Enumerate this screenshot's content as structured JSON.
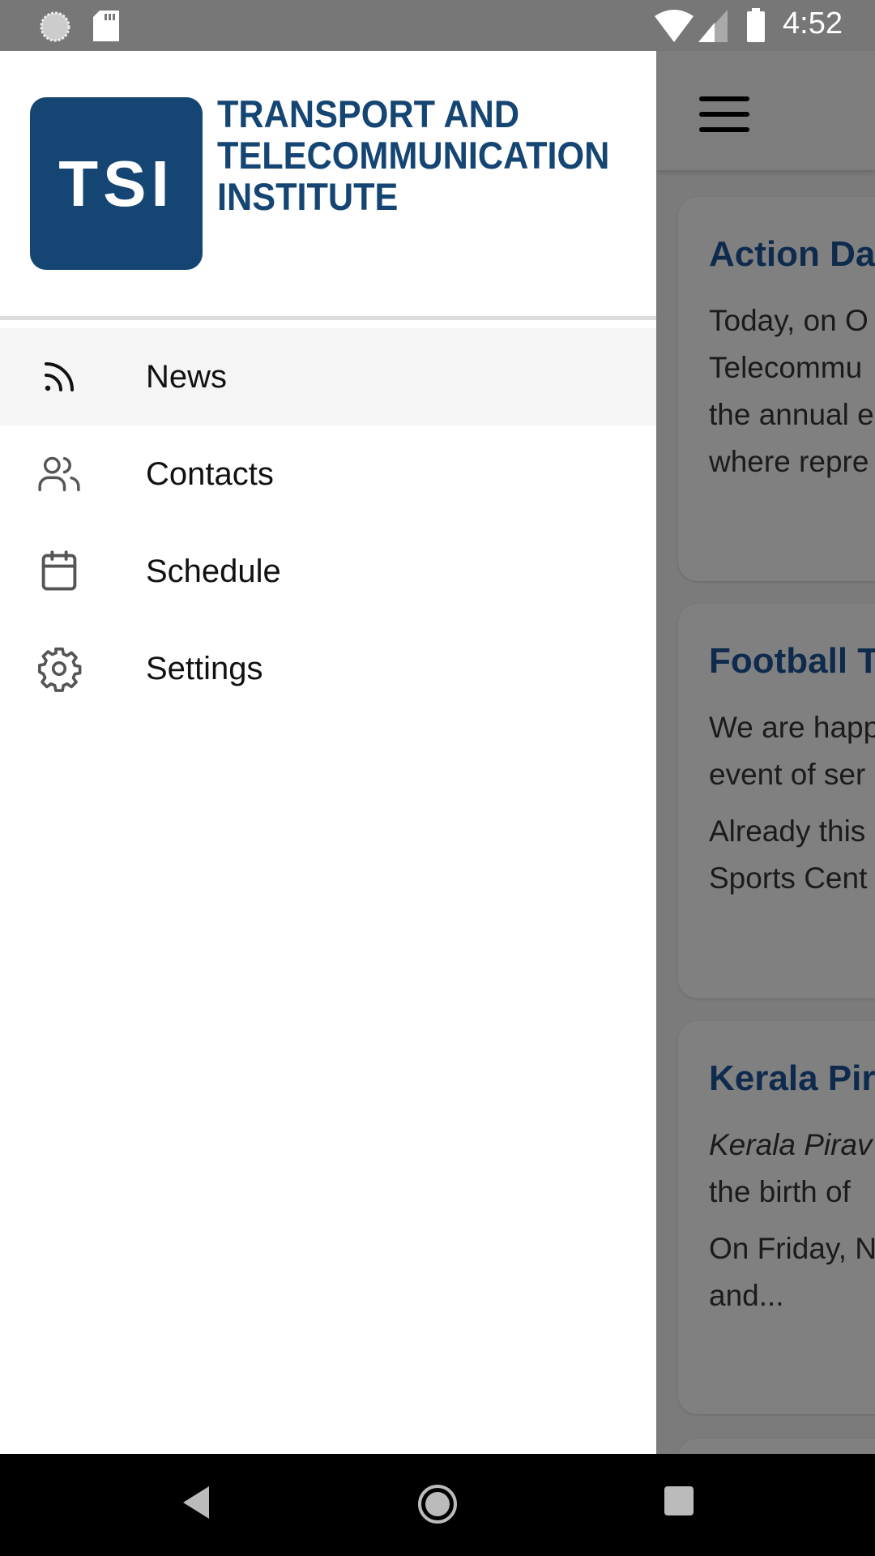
{
  "status_bar": {
    "time": "4:52",
    "icons": [
      "sync-icon",
      "sd-card-icon",
      "wifi-icon",
      "signal-icon",
      "battery-icon"
    ]
  },
  "drawer": {
    "logo": {
      "mark": "TSI",
      "text": [
        "TRANSPORT AND",
        "TELECOMMUNICATION",
        "INSTITUTE"
      ],
      "color": "#154673"
    },
    "items": [
      {
        "label": "News",
        "icon": "rss-icon",
        "active": true
      },
      {
        "label": "Contacts",
        "icon": "users-icon"
      },
      {
        "label": "Schedule",
        "icon": "calendar-icon"
      },
      {
        "label": "Settings",
        "icon": "gear-icon"
      }
    ]
  },
  "feed": {
    "cards": [
      {
        "title": "Action Da",
        "paragraphs": [
          [
            "Today, on O",
            "Telecommu",
            "the annual e",
            "where repre"
          ]
        ]
      },
      {
        "title": "Football T",
        "paragraphs": [
          [
            "We are happ",
            "event of ser"
          ],
          [
            "Already this",
            "Sports Cent"
          ]
        ]
      },
      {
        "title": "Kerala Pir",
        "paragraphs": [
          [
            "Kerala Pirav",
            "the birth of"
          ],
          [
            "On Friday, N",
            "and..."
          ]
        ]
      }
    ]
  },
  "nav_bar": {
    "icons": [
      "back-icon",
      "home-icon",
      "recents-icon"
    ]
  }
}
